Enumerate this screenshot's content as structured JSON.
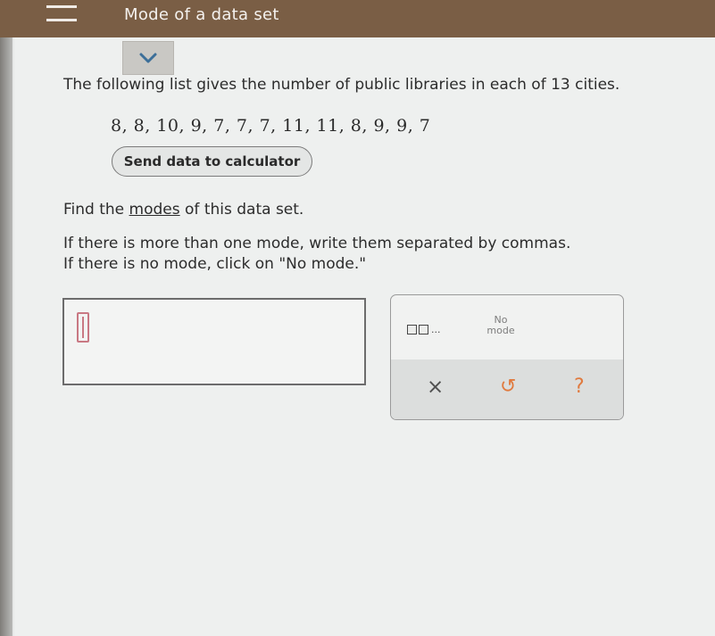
{
  "header": {
    "menu_icon": "hamburger-menu-icon",
    "title": "Mode of a data set",
    "collapse_icon": "chevron-down-icon",
    "background_color": "#7a5e45"
  },
  "problem": {
    "prompt": "The following list gives the number of public libraries in each of 13 cities.",
    "data_values": "8, 8, 10, 9, 7, 7, 7, 11, 11, 8, 9, 9, 7",
    "send_button": "Send data to calculator",
    "find_prefix": "Find the ",
    "find_link": "modes",
    "find_suffix": " of this data set.",
    "instruction_1": "If there is more than one mode, write them separated by commas.",
    "instruction_2": "If there is no mode, click on \"No mode.\""
  },
  "answer": {
    "value": "",
    "cursor_icon": "text-cursor-icon"
  },
  "toolbox": {
    "comma_list_icon": "comma-separated-boxes-icon",
    "comma_list_suffix": "...",
    "no_mode_label_line1": "No",
    "no_mode_label_line2": "mode",
    "clear_glyph": "×",
    "undo_glyph": "↺",
    "help_glyph": "?",
    "accent_color": "#e07a3e"
  }
}
